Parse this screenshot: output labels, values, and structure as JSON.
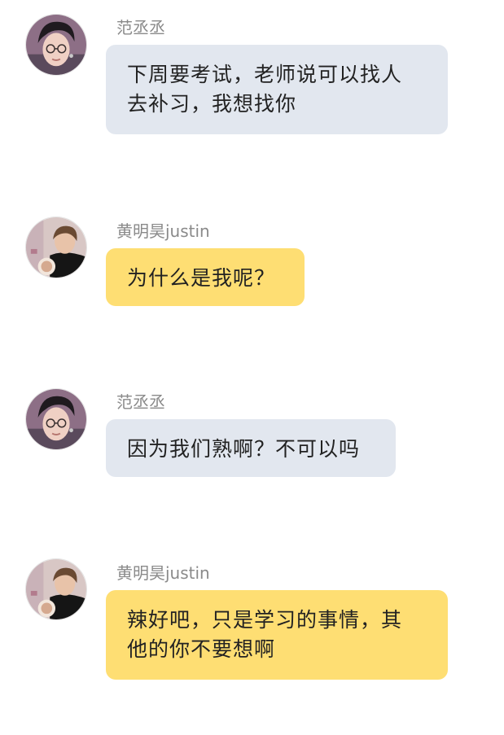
{
  "messages": [
    {
      "sender": "范丞丞",
      "avatar_icon": "avatar-fan-chengcheng",
      "lines": [
        "下周要考试，老师说可以找人",
        "去补习，我想找你"
      ]
    },
    {
      "sender": "黄明昊justin",
      "avatar_icon": "avatar-huang-minghao",
      "lines": [
        "为什么是我呢？"
      ]
    },
    {
      "sender": "范丞丞",
      "avatar_icon": "avatar-fan-chengcheng",
      "lines": [
        "因为我们熟啊？不可以吗"
      ]
    },
    {
      "sender": "黄明昊justin",
      "avatar_icon": "avatar-huang-minghao",
      "lines": [
        "辣好吧，只是学习的事情，其",
        "他的你不要想啊"
      ]
    }
  ],
  "colors": {
    "bubble_self": "#e2e7ef",
    "bubble_other": "#fede73",
    "name_text": "#8a8a8a",
    "message_text": "#222222"
  }
}
